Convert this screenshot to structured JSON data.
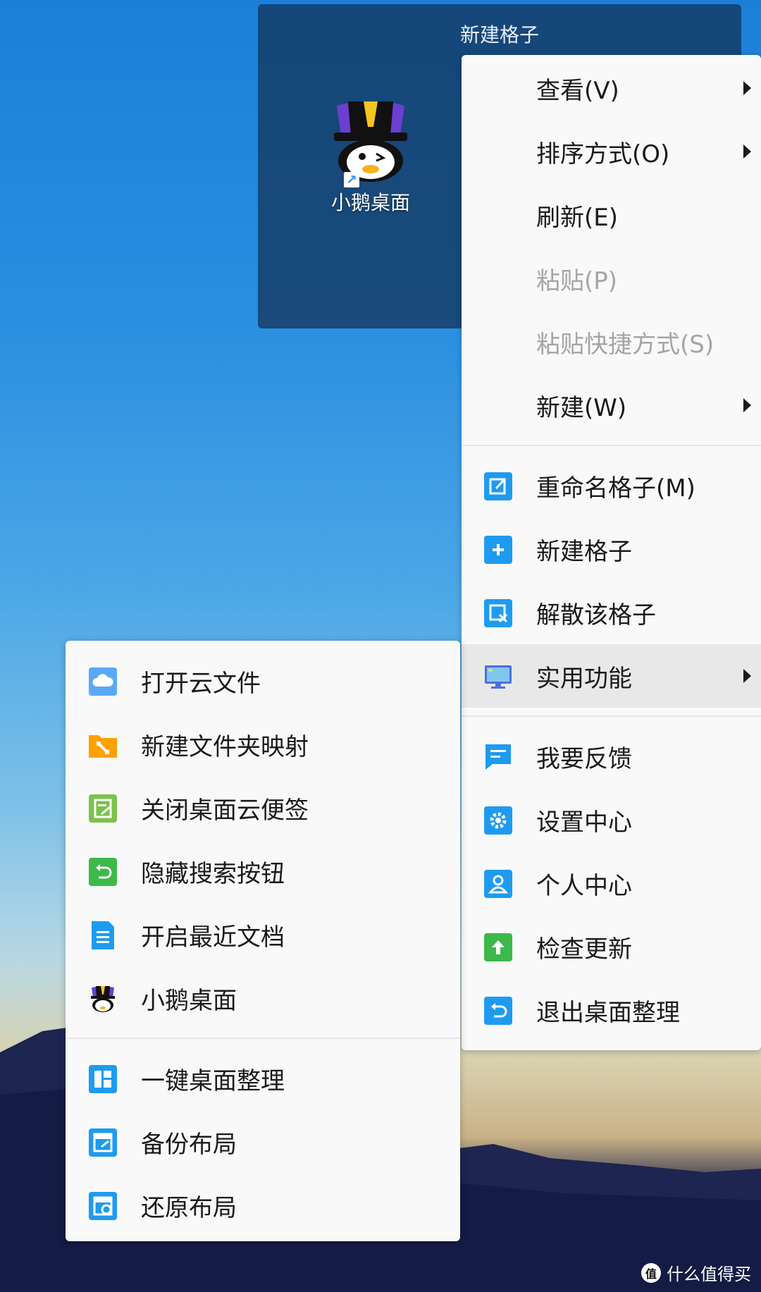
{
  "desktop": {
    "grid_title": "新建格子",
    "icon_label": "小鹅桌面",
    "shortcut_arrow": "↗"
  },
  "main_menu": {
    "view": "查看(V)",
    "sort": "排序方式(O)",
    "refresh": "刷新(E)",
    "paste": "粘贴(P)",
    "paste_shortcut": "粘贴快捷方式(S)",
    "new": "新建(W)",
    "rename_grid": "重命名格子(M)",
    "new_grid": "新建格子",
    "dissolve_grid": "解散该格子",
    "utilities": "实用功能",
    "feedback": "我要反馈",
    "settings": "设置中心",
    "profile": "个人中心",
    "check_update": "检查更新",
    "exit": "退出桌面整理"
  },
  "sub_menu": {
    "open_cloud_files": "打开云文件",
    "new_folder_mapping": "新建文件夹映射",
    "close_cloud_note": "关闭桌面云便签",
    "hide_search_button": "隐藏搜索按钮",
    "enable_recent_docs": "开启最近文档",
    "xiaoe_desktop": "小鹅桌面",
    "one_click_organize": "一键桌面整理",
    "backup_layout": "备份布局",
    "restore_layout": "还原布局"
  },
  "watermark": {
    "text": "什么值得买",
    "logo": "值"
  },
  "colors": {
    "icon_blue": "#1e9bf0",
    "icon_orange": "#ffa200",
    "icon_green": "#3cb94a",
    "icon_light_green": "#7cc24a",
    "disabled": "#a5a5a5"
  }
}
